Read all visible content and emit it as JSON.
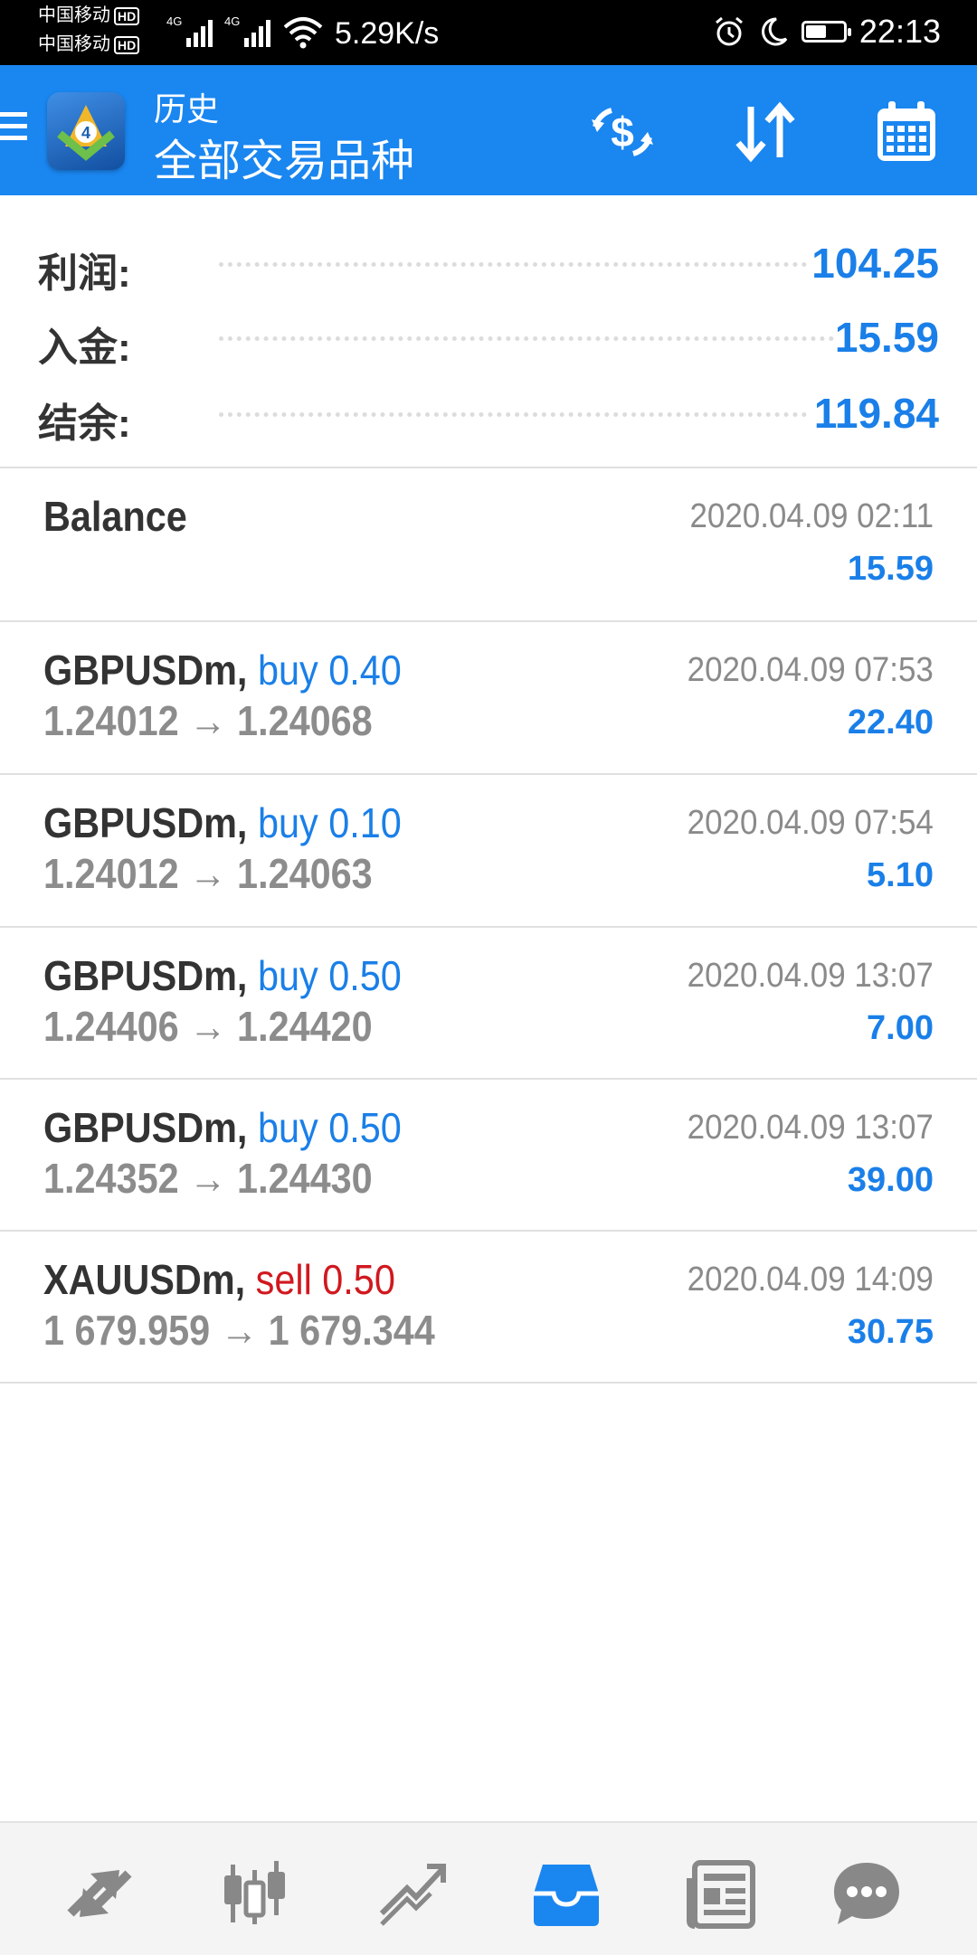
{
  "status_bar": {
    "carrier_1": "中国移动",
    "carrier_2": "中国移动",
    "hd_badge": "HD",
    "network_1": "4G",
    "network_2": "4G",
    "net_speed": "5.29K/s",
    "time": "22:13",
    "battery_level_percent": 55,
    "icons": [
      "signal-icon",
      "wifi-icon",
      "alarm-icon",
      "moon-icon",
      "battery-icon"
    ]
  },
  "app_bar": {
    "subtitle": "历史",
    "title": "全部交易品种",
    "accent_color": "#1a86f0",
    "icons": [
      "menu-icon",
      "metatrader-logo",
      "dollar-exchange-icon",
      "sort-icon",
      "calendar-icon"
    ]
  },
  "summary": [
    {
      "label": "利润:",
      "value": "104.25"
    },
    {
      "label": "入金:",
      "value": "15.59"
    },
    {
      "label": "结余:",
      "value": "119.84"
    }
  ],
  "balance_entry": {
    "label": "Balance",
    "datetime": "2020.04.09 02:11",
    "amount": "15.59"
  },
  "deals": [
    {
      "symbol": "GBPUSDm,",
      "side": "buy 0.40",
      "direction": "buy",
      "price_open": "1.24012",
      "price_close": "1.24068",
      "datetime": "2020.04.09 07:53",
      "profit": "22.40"
    },
    {
      "symbol": "GBPUSDm,",
      "side": "buy 0.10",
      "direction": "buy",
      "price_open": "1.24012",
      "price_close": "1.24063",
      "datetime": "2020.04.09 07:54",
      "profit": "5.10"
    },
    {
      "symbol": "GBPUSDm,",
      "side": "buy 0.50",
      "direction": "buy",
      "price_open": "1.24406",
      "price_close": "1.24420",
      "datetime": "2020.04.09 13:07",
      "profit": "7.00"
    },
    {
      "symbol": "GBPUSDm,",
      "side": "buy 0.50",
      "direction": "buy",
      "price_open": "1.24352",
      "price_close": "1.24430",
      "datetime": "2020.04.09 13:07",
      "profit": "39.00"
    },
    {
      "symbol": "XAUUSDm,",
      "side": "sell 0.50",
      "direction": "sell",
      "price_open": "1 679.959",
      "price_close": "1 679.344",
      "datetime": "2020.04.09 14:09",
      "profit": "30.75"
    }
  ],
  "arrow": "→",
  "colors": {
    "buy": "#1a7fe8",
    "sell": "#d0191f",
    "profit": "#1a7fe8"
  },
  "bottom_nav": [
    {
      "icon": "quotes-icon"
    },
    {
      "icon": "chart-icon"
    },
    {
      "icon": "trade-icon"
    },
    {
      "icon": "history-icon",
      "active": true
    },
    {
      "icon": "news-icon"
    },
    {
      "icon": "chat-icon"
    }
  ]
}
